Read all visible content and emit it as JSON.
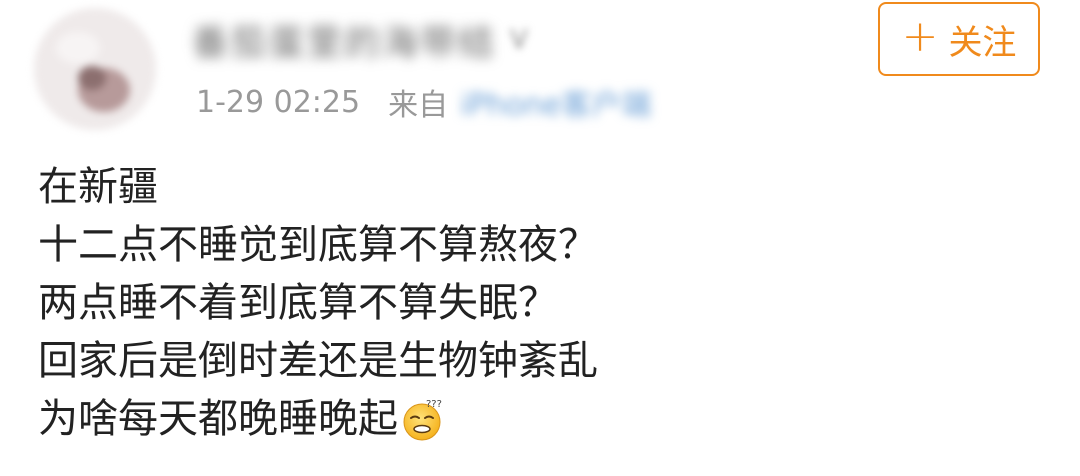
{
  "post": {
    "author": {
      "name": "番茄蛋里的海带结",
      "badge": "V"
    },
    "meta": {
      "time": "1-29 02:25",
      "from_label": "来自",
      "device": "iPhone客户端"
    },
    "follow_button": {
      "icon": "plus-icon",
      "label": "关注"
    },
    "content_lines": [
      "在新疆",
      "十二点不睡觉到底算不算熬夜？",
      "两点睡不着到底算不算失眠？",
      "回家后是倒时差还是生物钟紊乱",
      "为啥每天都晚睡晚起"
    ],
    "end_emoji": "confused-face-emoji"
  },
  "colors": {
    "accent": "#f08a1c",
    "text": "#222222",
    "meta_text": "#999999",
    "device_link": "#6a9fd6"
  }
}
